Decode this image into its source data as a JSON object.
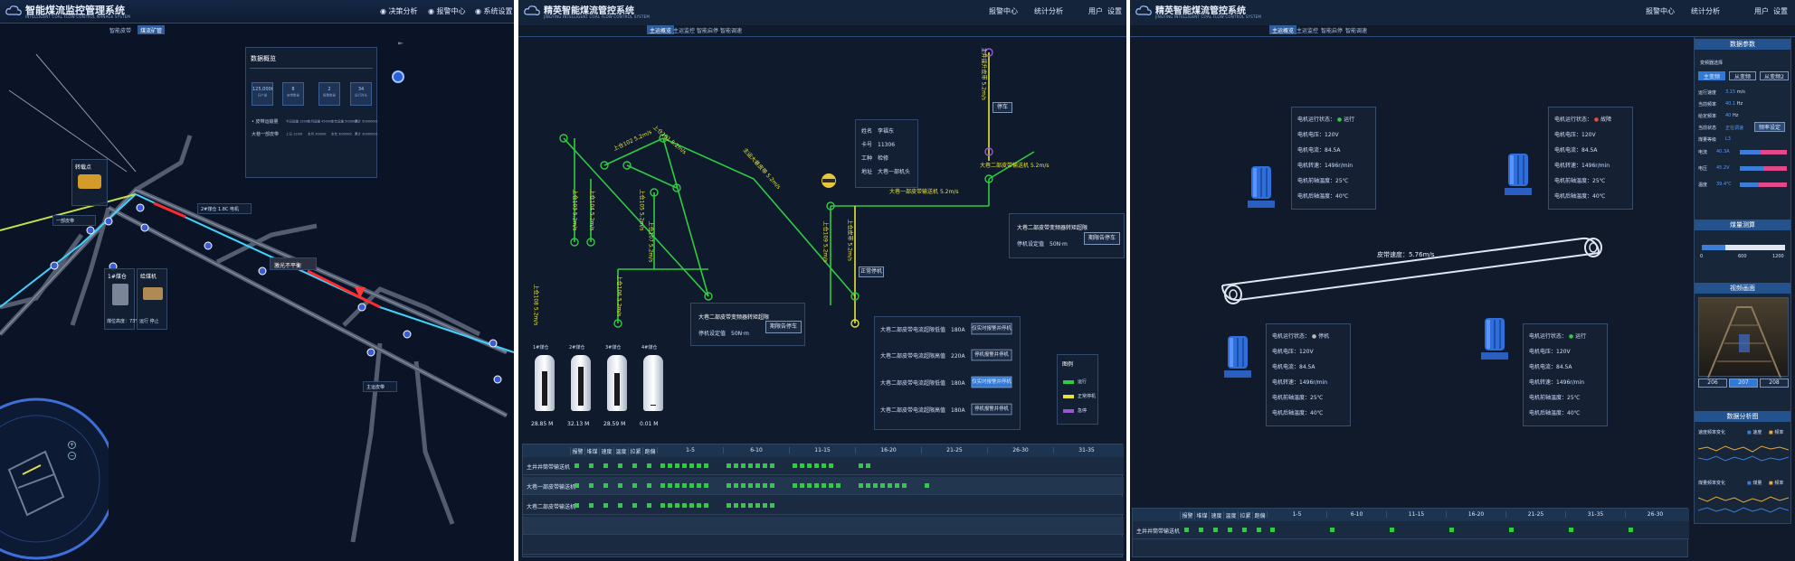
{
  "panel1": {
    "title": "智能煤流监控管理系统",
    "subtitle": "INTELLIGENT COAL FLOW CONTROL MANAGE SYSTEM",
    "nav": [
      "决策分析",
      "报警中心",
      "系统设置"
    ],
    "tabs": [
      "智能皮带",
      "煤流矿管"
    ],
    "data_overview": {
      "title": "数据概览",
      "stats": [
        {
          "value": "125,000t",
          "label": "日产量"
        },
        {
          "value": "8",
          "label": "皮带数量"
        },
        {
          "value": "2",
          "label": "报警数量"
        },
        {
          "value": "34",
          "label": "运行时长"
        }
      ],
      "rows": [
        {
          "label": "• 皮带运输量",
          "vals": [
            "今日运输 1500t",
            "本月运输 45000t",
            "本年运输 500000t",
            "累计 5000000t"
          ]
        },
        {
          "label": "大巷一部皮带",
          "vals": [
            "上日 1200t",
            "本月 30000t",
            "本年 300000t",
            "累计 3000000t"
          ]
        }
      ]
    },
    "labels": [
      {
        "id": "l1",
        "text": "转载点"
      },
      {
        "id": "l2",
        "text": "一部皮带"
      },
      {
        "id": "l3",
        "text": "2#煤仓 1.8C 电机"
      },
      {
        "id": "l4",
        "text": "激光不平衡"
      },
      {
        "id": "l5",
        "text": "主运皮带"
      }
    ],
    "bin_panels": [
      {
        "title": "1#煤仓",
        "text": "煤位高度：73%"
      },
      {
        "title": "给煤机",
        "text": "运行 停止"
      }
    ]
  },
  "panel2": {
    "title": "精英智能煤流管控系统",
    "subtitle": "JINGYING INTELLIGENT COAL FLOW CONTROL SYSTEM",
    "nav": [
      "报警中心",
      "统计分析",
      "用户",
      "设置"
    ],
    "tabs": [
      "主运概览",
      "主运监控",
      "智能启停",
      "智能调速"
    ],
    "person": {
      "name_label": "姓名",
      "name": "李福东",
      "card_label": "卡号",
      "card": "11306",
      "job_label": "工种",
      "job": "检修",
      "loc_label": "地址",
      "loc": "大巷一部机头"
    },
    "belts": [
      {
        "label": "大巷一部皮带输送机",
        "speed": "5.2m/s"
      },
      {
        "label": "大巷二部皮带输送机",
        "speed": "5.2m/s"
      },
      {
        "label": "上仓皮带",
        "speed": "5.2m/s"
      },
      {
        "label": "主井提升皮带",
        "speed": "5.2m/s"
      },
      {
        "label": "上仓101",
        "speed": "5.2m/s"
      },
      {
        "label": "上仓102",
        "speed": "5.2m/s"
      },
      {
        "label": "上仓103",
        "speed": "5.2m/s"
      },
      {
        "label": "上仓104",
        "speed": "5.2m/s"
      },
      {
        "label": "上仓105",
        "speed": "5.2m/s"
      },
      {
        "label": "上仓106",
        "speed": "5.2m/s"
      },
      {
        "label": "上仓107",
        "speed": "5.2m/s"
      },
      {
        "label": "上仓108",
        "speed": "5.2m/s"
      },
      {
        "label": "上仓109",
        "speed": "5.2m/s"
      },
      {
        "label": "主运大巷皮带",
        "speed": "5.2m/s"
      }
    ],
    "stop_btn": "停车",
    "normal_btn": "正常停机",
    "alarm1": {
      "title": "大巷二部皮带变频器转矩超限",
      "sub_label": "停机设定值",
      "sub_value": "50N·m",
      "btn": "期限告停车"
    },
    "alarm2": {
      "title": "大巷二部皮带变频器转矩超限",
      "sub_label": "停机设定值",
      "sub_value": "50N·m",
      "btn": "期限告停车"
    },
    "current_alarms": [
      {
        "text": "大巷二部皮带电流超限低值",
        "value": "180A",
        "btn": "仅实时报警并停机"
      },
      {
        "text": "大巷二部皮带电流超限高值",
        "value": "220A",
        "btn": "停机报警并停机"
      },
      {
        "text": "大巷二部皮带电流超限低值",
        "value": "180A",
        "btn": "仅实时报警并停机"
      },
      {
        "text": "大巷二部皮带电流超限高值",
        "value": "180A",
        "btn": "停机报警并停机"
      }
    ],
    "legend": {
      "title": "图例",
      "items": [
        {
          "label": "运行",
          "color": "#2ecc40"
        },
        {
          "label": "正常停机",
          "color": "#e8e23a"
        },
        {
          "label": "急停",
          "color": "#9b59d0"
        }
      ]
    },
    "bins": [
      {
        "name": "1#煤仓",
        "value": "28.85",
        "unit": "M",
        "level": 0.75
      },
      {
        "name": "2#煤仓",
        "value": "32.13",
        "unit": "M",
        "level": 0.85
      },
      {
        "name": "3#煤仓",
        "value": "28.59",
        "unit": "M",
        "level": 0.72
      },
      {
        "name": "4#煤仓",
        "value": "0.01",
        "unit": "M",
        "level": 0.02
      }
    ],
    "table": {
      "headers": [
        "报警",
        "堆煤",
        "速度",
        "温度",
        "拉紧",
        "跑偏",
        "1-5",
        "6-10",
        "11-15",
        "16-20",
        "21-25",
        "26-30",
        "31-35"
      ],
      "rows": [
        {
          "name": "主井井筒带输送机",
          "cells": [
            1,
            1,
            1,
            1,
            1,
            1,
            7,
            7,
            6,
            2,
            0,
            0,
            0
          ]
        },
        {
          "name": "大巷一部皮带输送机",
          "cells": [
            1,
            1,
            1,
            1,
            1,
            1,
            7,
            7,
            7,
            7,
            1,
            0,
            0
          ]
        },
        {
          "name": "大巷二部皮带输送机",
          "cells": [
            1,
            1,
            1,
            1,
            1,
            1,
            7,
            7,
            0,
            0,
            0,
            0,
            0
          ]
        },
        {
          "name": "",
          "cells": []
        },
        {
          "name": "",
          "cells": []
        }
      ]
    }
  },
  "panel3": {
    "title": "精英智能煤流管控系统",
    "subtitle": "JINGYING INTELLIGENT COAL FLOW CONTROL SYSTEM",
    "nav": [
      "报警中心",
      "统计分析",
      "用户",
      "设置"
    ],
    "tabs": [
      "主运概览",
      "主运监控",
      "智能启停",
      "智能调速"
    ],
    "belt_speed": "皮带速度：5.76m/s",
    "motors": [
      {
        "status_label": "电机运行状态：",
        "status": "运行",
        "status_color": "#2ecc40",
        "rows": [
          "电机电压：120V",
          "电机电流：84.5A",
          "电机转速：1496r/min",
          "电机前轴温度：25℃",
          "电机后轴温度：40℃"
        ]
      },
      {
        "status_label": "电机运行状态：",
        "status": "故障",
        "status_color": "#e74c3c",
        "rows": [
          "电机电压：120V",
          "电机电流：84.5A",
          "电机转速：1496r/min",
          "电机前轴温度：25℃",
          "电机后轴温度：40℃"
        ]
      },
      {
        "status_label": "电机运行状态：",
        "status": "停机",
        "status_color": "#bbbbbb",
        "rows": [
          "电机电压：120V",
          "电机电流：84.5A",
          "电机转速：1496r/min",
          "电机前轴温度：25℃",
          "电机后轴温度：40℃"
        ]
      },
      {
        "status_label": "电机运行状态：",
        "status": "运行",
        "status_color": "#2ecc40",
        "rows": [
          "电机电压：120V",
          "电机电流：84.5A",
          "电机转速：1496r/min",
          "电机前轴温度：25℃",
          "电机后轴温度：40℃"
        ]
      }
    ],
    "side": {
      "params_title": "数据参数",
      "freq_label": "变频器选择",
      "freq_btns": [
        "主变频",
        "从变频",
        "从变频2"
      ],
      "params": [
        {
          "label": "运行速度",
          "value": "3.15",
          "unit": "m/s"
        },
        {
          "label": "当前频率",
          "value": "40.1",
          "unit": "Hz"
        },
        {
          "label": "给定频率",
          "value": "40",
          "unit": "Hz"
        },
        {
          "label": "当前状态",
          "value": "正在调速",
          "unit": ""
        },
        {
          "label": "煤量等级",
          "value": "L3",
          "unit": ""
        }
      ],
      "set_freq_btn": "频率设定",
      "meters": [
        {
          "label": "电流",
          "value": "40.3A",
          "level": 0.45
        },
        {
          "label": "电压",
          "value": "45.2V",
          "level": 0.5
        },
        {
          "label": "温度",
          "value": "39.4℃",
          "level": 0.4
        }
      ],
      "coal_title": "煤量测算",
      "coal_ticks": [
        "0",
        "600",
        "1200"
      ],
      "coal_level": 0.28,
      "video_title": "视频画面",
      "video_tabs": [
        "206",
        "207",
        "208"
      ],
      "analysis_title": "数据分析图",
      "chart1": {
        "title": "速度频率变化",
        "legend": [
          "速度",
          "频率"
        ]
      },
      "chart2": {
        "title": "煤量频率变化",
        "legend": [
          "煤量",
          "频率"
        ]
      }
    },
    "table": {
      "headers": [
        "报警",
        "堆煤",
        "速度",
        "温度",
        "拉紧",
        "跑偏",
        "1-5",
        "6-10",
        "11-15",
        "16-20",
        "21-25",
        "31-35",
        "26-30"
      ],
      "rows": [
        {
          "name": "主井井筒带输送机",
          "cells": [
            1,
            1,
            1,
            1,
            1,
            1,
            1,
            1,
            1,
            1,
            1,
            1,
            1
          ]
        }
      ]
    }
  }
}
